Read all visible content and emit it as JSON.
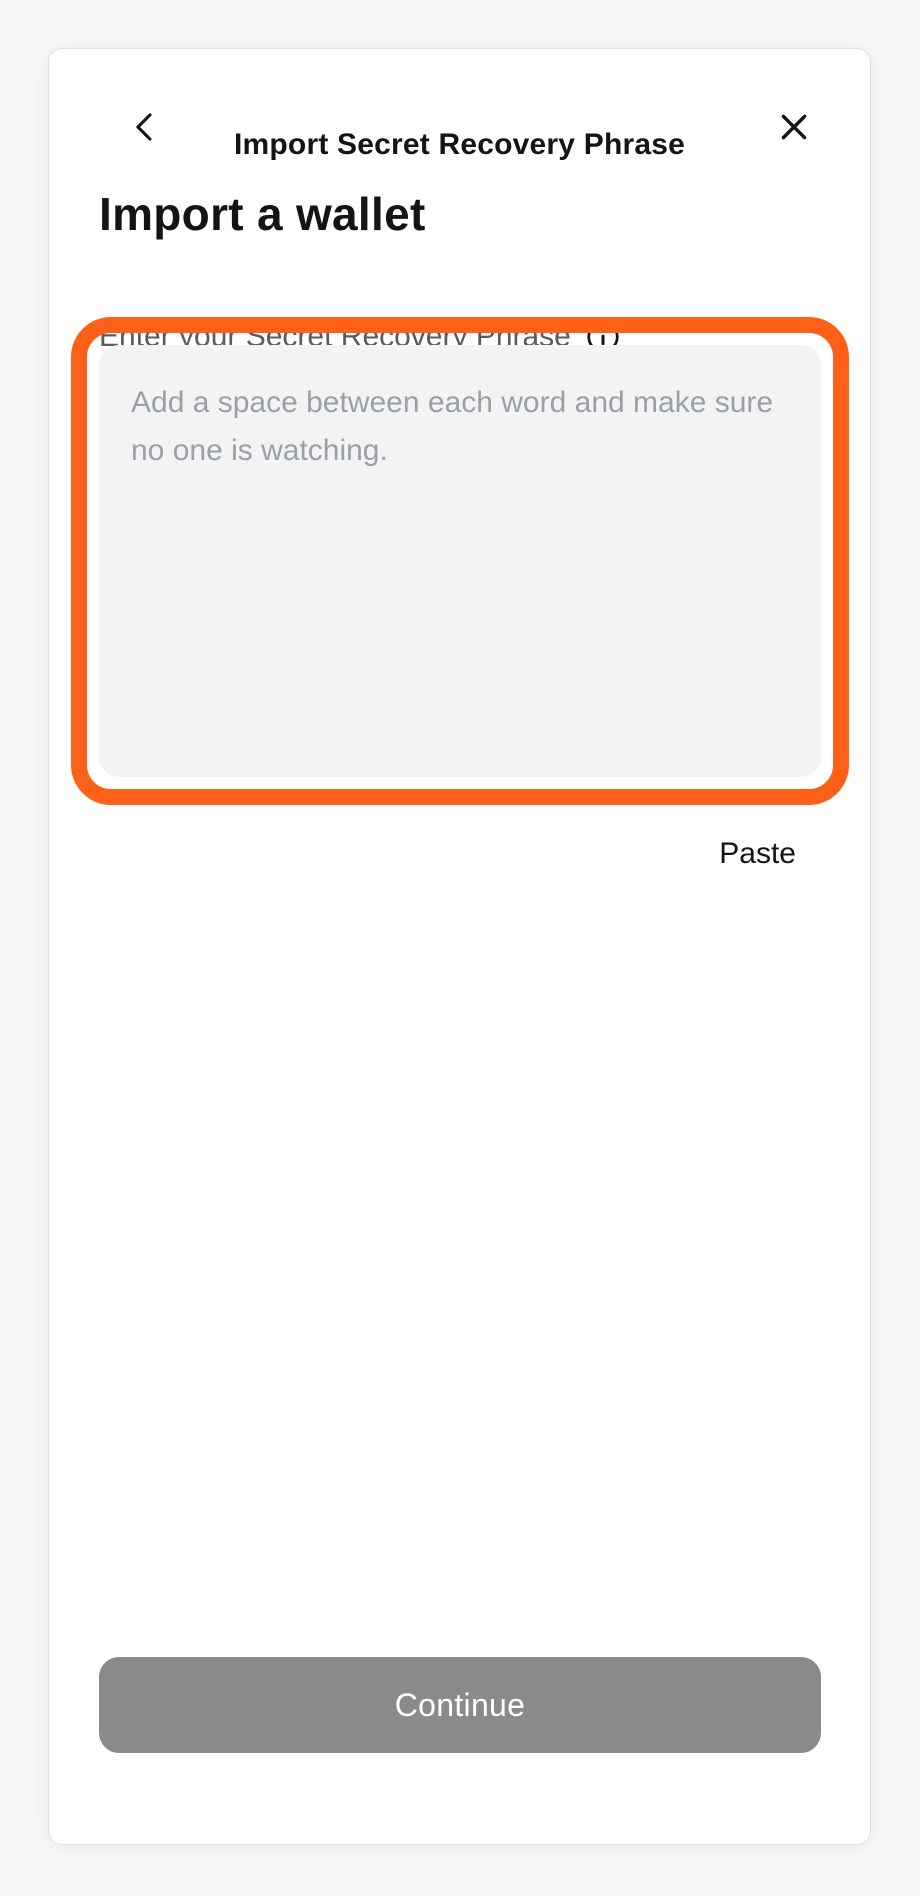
{
  "header": {
    "title": "Import Secret Recovery Phrase",
    "back_icon": "chevron-left-icon",
    "close_icon": "close-icon"
  },
  "main": {
    "title": "Import a wallet",
    "label": "Enter your Secret Recovery Phrase",
    "info_icon": "info-icon",
    "phrase_input": {
      "value": "",
      "placeholder": "Add a space between each word and make sure no one is watching."
    },
    "paste_label": "Paste",
    "continue_label": "Continue"
  },
  "colors": {
    "highlight": "#fe6019",
    "input_bg": "#f3f3f3",
    "continue_disabled": "#8a8a8a",
    "placeholder": "#9aa0aa"
  }
}
